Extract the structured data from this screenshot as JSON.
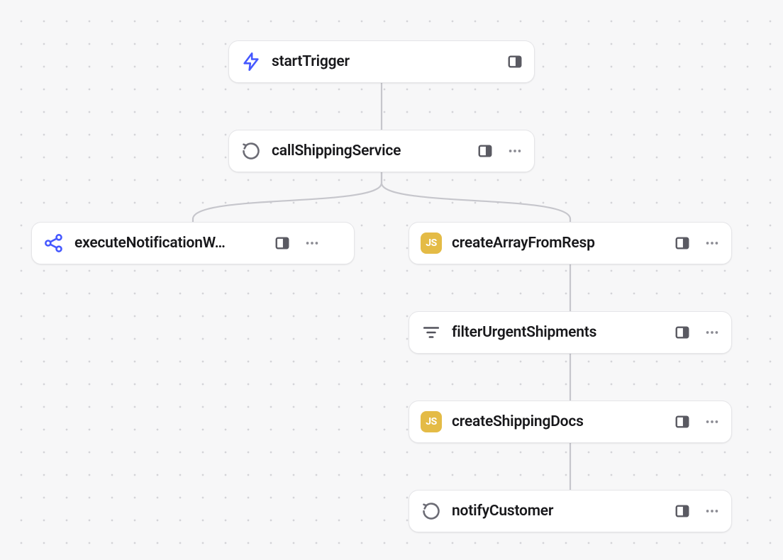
{
  "nodes": {
    "startTrigger": {
      "label": "startTrigger",
      "icon": "bolt-icon"
    },
    "callShippingService": {
      "label": "callShippingService",
      "icon": "loop-icon"
    },
    "executeNotification": {
      "label": "executeNotificationW…",
      "icon": "share-icon"
    },
    "createArrayFromResp": {
      "label": "createArrayFromResp",
      "icon": "js-icon",
      "js_text": "JS"
    },
    "filterUrgentShipments": {
      "label": "filterUrgentShipments",
      "icon": "filter-icon"
    },
    "createShippingDocs": {
      "label": "createShippingDocs",
      "icon": "js-icon",
      "js_text": "JS"
    },
    "notifyCustomer": {
      "label": "notifyCustomer",
      "icon": "loop-icon"
    }
  }
}
